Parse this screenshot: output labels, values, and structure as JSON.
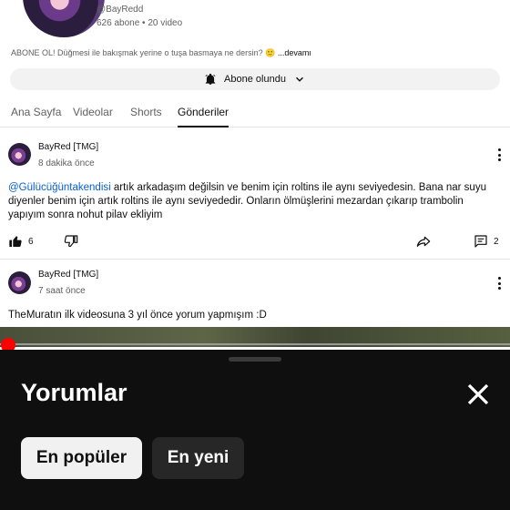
{
  "channel": {
    "handle": "@BayRedd",
    "stats": "626 abone • 20 video",
    "description": "ABONE OL! Düğmesi ile bakışmak yerine o tuşa basmaya ne dersin? 🙂",
    "more_label": " ...devamı",
    "subscribe_label": "Abone olundu"
  },
  "tabs": [
    {
      "label": "Ana Sayfa",
      "active": false
    },
    {
      "label": "Videolar",
      "active": false
    },
    {
      "label": "Shorts",
      "active": false
    },
    {
      "label": "Gönderiler",
      "active": true
    }
  ],
  "posts": [
    {
      "author": "BayRed [TMG]",
      "time": "8 dakika önce",
      "mention": "@Gülücüğüntakendisi",
      "text": " artık arkadaşım değilsin ve benim için roltins ile aynı seviyedesin. Bana nar suyu diyenler benim için artık roltins ile aynı seviyededir. Onların ölmüşlerini mezardan çıkarıp trambolin yapıyım sonra nohut pilav ekliyim",
      "likes": "6",
      "comments": "2"
    },
    {
      "author": "BayRed [TMG]",
      "time": "7 saat önce",
      "text": "TheMuratın ilk videosuna 3 yıl önce yorum yapmışım :D"
    }
  ],
  "comments_sheet": {
    "title": "Yorumlar",
    "chips": [
      {
        "label": "En popüler",
        "selected": true
      },
      {
        "label": "En yeni",
        "selected": false
      }
    ]
  },
  "colors": {
    "link": "#065fd4",
    "progress": "#ff0000",
    "sheet_bg": "#0f0f0f"
  }
}
